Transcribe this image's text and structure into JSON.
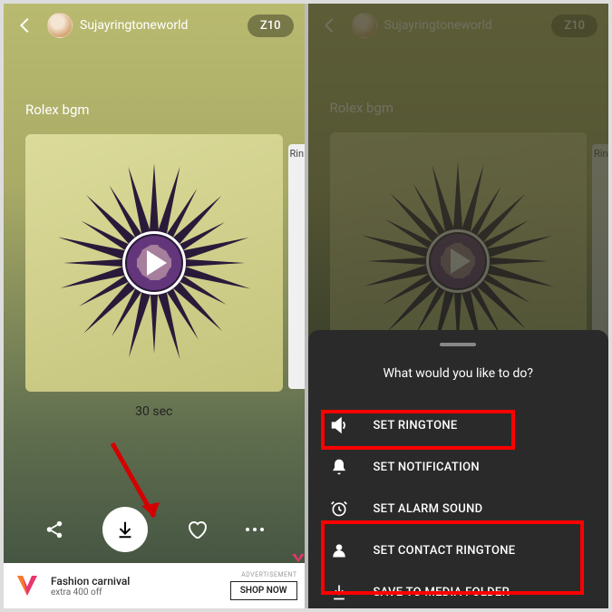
{
  "header": {
    "username": "Sujayringtoneworld",
    "badge": "Z10"
  },
  "song": {
    "title": "Rolex bgm",
    "duration": "30 sec",
    "peek": "Rin"
  },
  "sheet": {
    "prompt": "What would you like to do?",
    "options": [
      {
        "label": "SET RINGTONE"
      },
      {
        "label": "SET NOTIFICATION"
      },
      {
        "label": "SET ALARM SOUND"
      },
      {
        "label": "SET CONTACT RINGTONE"
      },
      {
        "label": "SAVE TO MEDIA FOLDER"
      }
    ]
  },
  "ad": {
    "title": "Fashion carnival",
    "subtitle": "extra 400 off",
    "tag": "ADVERTISEMENT",
    "button": "SHOP NOW"
  }
}
